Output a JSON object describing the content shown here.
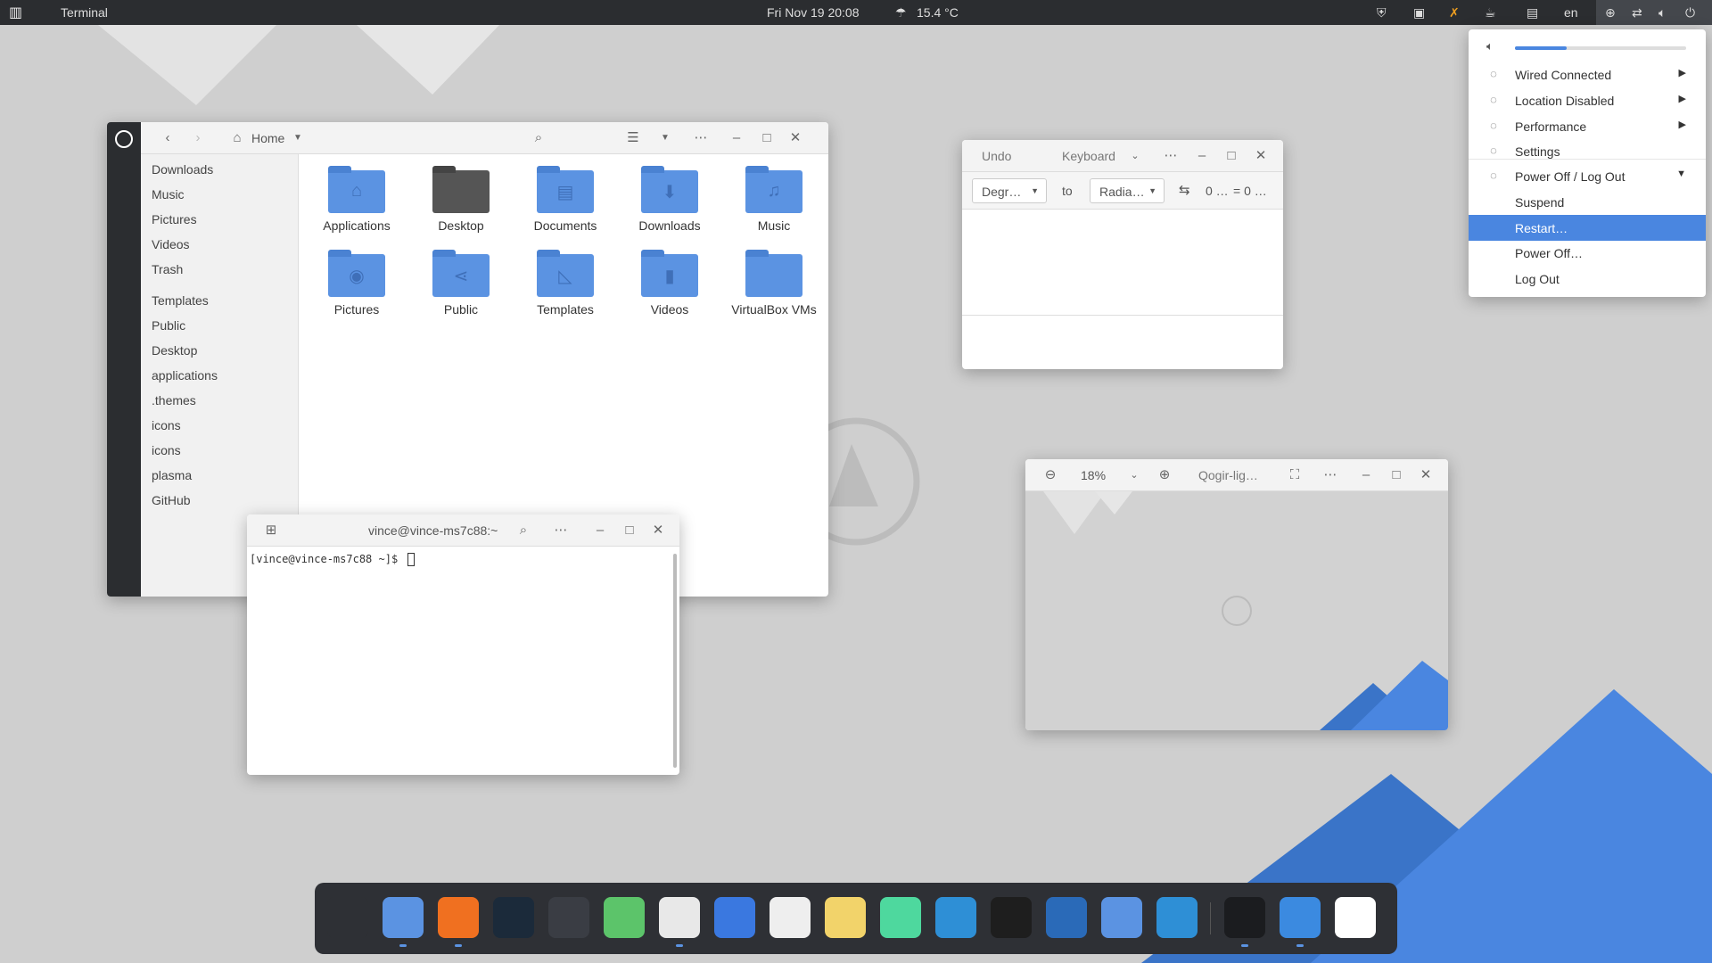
{
  "topbar": {
    "app_name": "Terminal",
    "clock": "Fri Nov 19  20:08",
    "weather": "15.4 °C",
    "lang": "en"
  },
  "files": {
    "location": "Home",
    "sidebar": [
      {
        "icon": "download-icon",
        "label": "Downloads"
      },
      {
        "icon": "music-icon",
        "label": "Music"
      },
      {
        "icon": "pictures-icon",
        "label": "Pictures"
      },
      {
        "icon": "videos-icon",
        "label": "Videos"
      },
      {
        "icon": "trash-icon",
        "label": "Trash"
      },
      {
        "icon": "templates-icon",
        "label": "Templates"
      },
      {
        "icon": "share-icon",
        "label": "Public"
      },
      {
        "icon": "desktop-icon",
        "label": "Desktop"
      },
      {
        "icon": "folder-icon",
        "label": "applications"
      },
      {
        "icon": "folder-icon",
        "label": ".themes"
      },
      {
        "icon": "folder-icon",
        "label": "icons"
      },
      {
        "icon": "folder-icon",
        "label": "icons"
      },
      {
        "icon": "folder-icon",
        "label": "plasma"
      },
      {
        "icon": "folder-icon",
        "label": "GitHub"
      }
    ],
    "items": [
      {
        "label": "Applications",
        "glyph": "⌂"
      },
      {
        "label": "Desktop",
        "glyph": ""
      },
      {
        "label": "Documents",
        "glyph": "▤"
      },
      {
        "label": "Downloads",
        "glyph": "⬇"
      },
      {
        "label": "Music",
        "glyph": "♫"
      },
      {
        "label": "Pictures",
        "glyph": "◉"
      },
      {
        "label": "Public",
        "glyph": "⋖"
      },
      {
        "label": "Templates",
        "glyph": "◺"
      },
      {
        "label": "Videos",
        "glyph": "▮"
      },
      {
        "label": "VirtualBox VMs",
        "glyph": ""
      }
    ]
  },
  "terminal": {
    "title": "vince@vince-ms7c88:~",
    "prompt": "[vince@vince-ms7c88 ~]$"
  },
  "converter": {
    "undo": "Undo",
    "mode": "Keyboard",
    "from_unit": "Degr…",
    "to_label": "to",
    "to_unit": "Radia…",
    "from_value": "0 …",
    "result": "= 0 …"
  },
  "viewer": {
    "zoom": "18%",
    "title": "Qogir-lig…"
  },
  "menu": {
    "volume_percent": 30,
    "items": [
      {
        "icon": "network-icon",
        "label": "Wired Connected",
        "arrow": "▶"
      },
      {
        "icon": "location-icon",
        "label": "Location Disabled",
        "arrow": "▶"
      },
      {
        "icon": "performance-icon",
        "label": "Performance",
        "arrow": "▶"
      },
      {
        "icon": "settings-icon",
        "label": "Settings",
        "arrow": ""
      },
      {
        "icon": "power-icon",
        "label": "Power Off / Log Out",
        "arrow": "▼"
      }
    ],
    "sub_items": [
      "Suspend",
      "Restart…",
      "Power Off…",
      "Log Out"
    ],
    "selected": "Restart…"
  },
  "colors": {
    "accent": "#4a86e0",
    "panel": "#2b2d30",
    "folder": "#5b93e2"
  }
}
